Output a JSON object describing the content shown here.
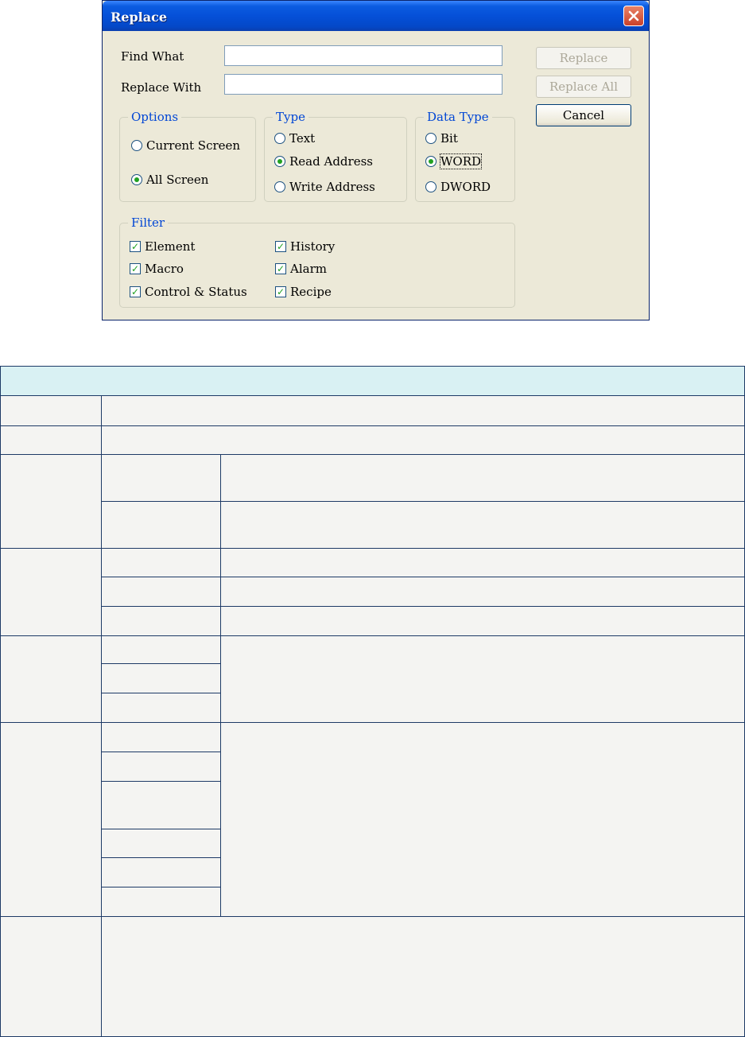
{
  "dialog": {
    "title": "Replace",
    "find_what_label": "Find What",
    "find_what_value": "",
    "replace_with_label": "Replace With",
    "replace_with_value": "",
    "buttons": {
      "replace": "Replace",
      "replace_all": "Replace All",
      "cancel": "Cancel"
    },
    "options": {
      "legend": "Options",
      "items": [
        "Current Screen",
        "All Screen"
      ],
      "selected": "All Screen"
    },
    "type": {
      "legend": "Type",
      "items": [
        "Text",
        "Read Address",
        "Write Address"
      ],
      "selected": "Read Address"
    },
    "data_type": {
      "legend": "Data Type",
      "items": [
        "Bit",
        "WORD",
        "DWORD"
      ],
      "selected": "WORD"
    },
    "filter": {
      "legend": "Filter",
      "items": [
        "Element",
        "History",
        "Macro",
        "Alarm",
        "Control & Status",
        "Recipe"
      ],
      "checked": [
        true,
        true,
        true,
        true,
        true,
        true
      ]
    }
  },
  "colors": {
    "title_bar": "#0550d8",
    "dialog_bg": "#ece9d8",
    "group_legend": "#0046d5",
    "check_mark": "#21a121",
    "table_header": "#d9f1f3",
    "table_border": "#1d3a66"
  },
  "icons": {
    "close": "close-icon"
  }
}
